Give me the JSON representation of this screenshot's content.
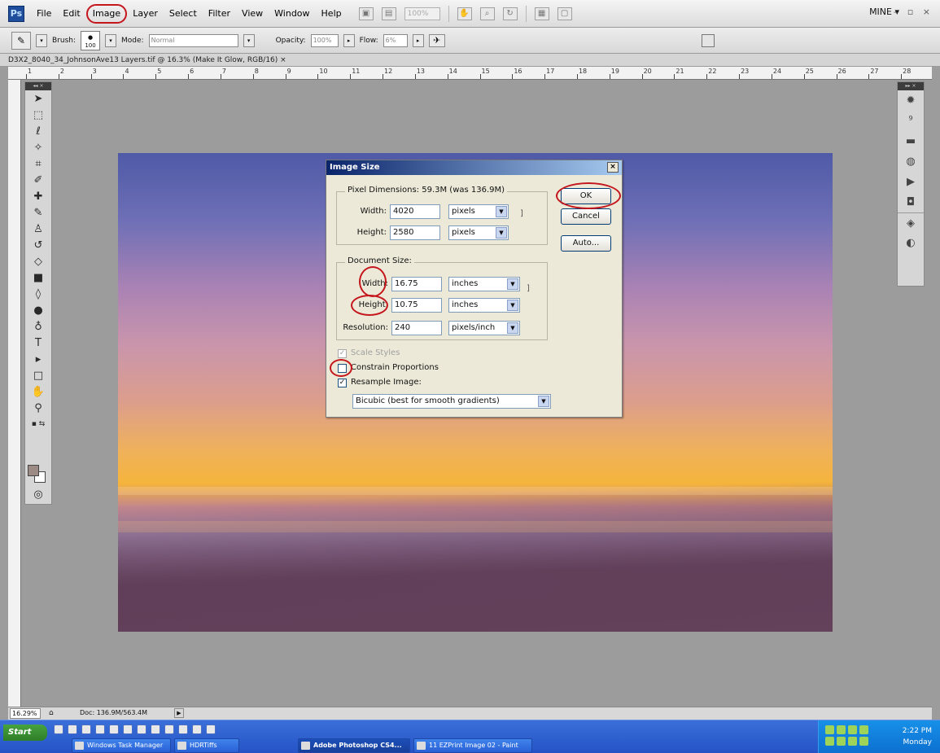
{
  "menubar": {
    "logo": "Ps",
    "items": [
      "File",
      "Edit",
      "Image",
      "Layer",
      "Select",
      "Filter",
      "View",
      "Window",
      "Help"
    ],
    "zoom": "100%",
    "workspace": "MINE ▾",
    "window_controls": "– ▫ ×"
  },
  "options": {
    "brush_label": "Brush:",
    "brush_size": "100",
    "mode_label": "Mode:",
    "mode_value": "Normal",
    "opacity_label": "Opacity:",
    "opacity_value": "100%",
    "flow_label": "Flow:",
    "flow_value": "6%"
  },
  "document": {
    "tab_title": "D3X2_8040_34_JohnsonAve13 Layers.tif @ 16.3% (Make It Glow, RGB/16)  ×"
  },
  "ruler": {
    "marks": [
      "1",
      "2",
      "3",
      "4",
      "5",
      "6",
      "7",
      "8",
      "9",
      "10",
      "11",
      "12",
      "13",
      "14",
      "15",
      "16",
      "17",
      "18",
      "19",
      "20",
      "21",
      "22",
      "23",
      "24",
      "25",
      "26",
      "27",
      "28"
    ]
  },
  "dialog": {
    "title": "Image Size",
    "close": "×",
    "pixel_dimensions_label": "Pixel Dimensions:  59.3M (was 136.9M)",
    "px_width_label": "Width:",
    "px_width_value": "4020",
    "px_width_unit": "pixels",
    "px_height_label": "Height:",
    "px_height_value": "2580",
    "px_height_unit": "pixels",
    "document_size_label": "Document Size:",
    "doc_width_label": "Width:",
    "doc_width_value": "16.75",
    "doc_width_unit": "inches",
    "doc_height_label": "Height:",
    "doc_height_value": "10.75",
    "doc_height_unit": "inches",
    "resolution_label": "Resolution:",
    "resolution_value": "240",
    "resolution_unit": "pixels/inch",
    "scale_styles_label": "Scale Styles",
    "scale_styles_checked": true,
    "constrain_label": "Constrain Proportions",
    "constrain_checked": false,
    "resample_label": "Resample Image:",
    "resample_checked": true,
    "resample_method": "Bicubic (best for smooth gradients)",
    "ok_label": "OK",
    "cancel_label": "Cancel",
    "auto_label": "Auto...",
    "annotation_color": "#c4161c"
  },
  "statusbar": {
    "zoom": "16.29%",
    "doc_info": "Doc: 136.9M/563.4M"
  },
  "taskbar": {
    "start_label": "Start",
    "tasks": [
      "Windows Task Manager",
      "HDRTiffs",
      "Adobe Photoshop CS4...",
      "11 EZPrint Image 02 - Paint"
    ],
    "time": "2:22 PM",
    "day": "Monday"
  }
}
